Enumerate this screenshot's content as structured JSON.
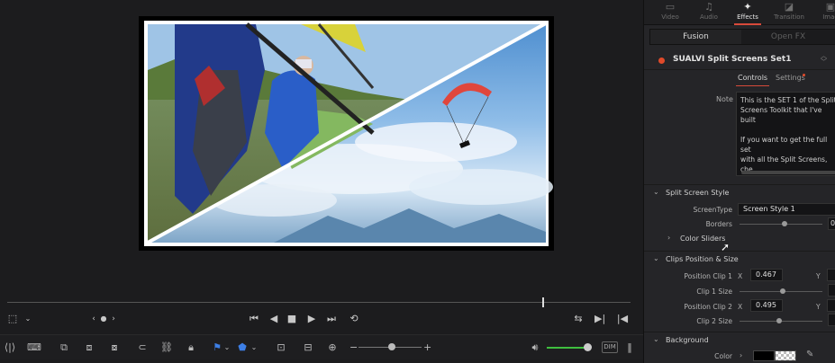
{
  "inspector": {
    "tabs": [
      {
        "label": "Video",
        "icon": "video-icon"
      },
      {
        "label": "Audio",
        "icon": "audio-icon"
      },
      {
        "label": "Effects",
        "icon": "effects-icon"
      },
      {
        "label": "Transition",
        "icon": "transition-icon"
      },
      {
        "label": "Imag",
        "icon": "image-icon"
      }
    ],
    "subtabs": [
      "Fusion",
      "Open FX"
    ],
    "effect_name": "SUALVI Split Screens Set1",
    "control_tabs": [
      "Controls",
      "Settings"
    ],
    "note_label": "Note",
    "note_text": "This is the SET 1 of the Split\nScreens Toolkit that I've built\n\nIf you want to get the full set\nwith all the Split Screens, che\nout at sualvi.com",
    "section_split": "Split Screen Style",
    "screen_type_label": "ScreenType",
    "screen_type_value": "Screen Style 1",
    "borders_label": "Borders",
    "borders_value": "0",
    "color_sliders_label": "Color Sliders",
    "section_clips": "Clips Position & Size",
    "pos_clip1_label": "Position Clip 1",
    "pos_clip1_x": "0.467",
    "clip1_size_label": "Clip 1 Size",
    "pos_clip2_label": "Position Clip 2",
    "pos_clip2_x": "0.495",
    "clip2_size_label": "Clip 2 Size",
    "x_label": "X",
    "y_label": "Y",
    "section_background": "Background",
    "color_label": "Color"
  },
  "toolbar": {
    "dim_label": "DIM"
  },
  "accent_color": "#d84a3a",
  "volume_color": "#3fbf3f"
}
